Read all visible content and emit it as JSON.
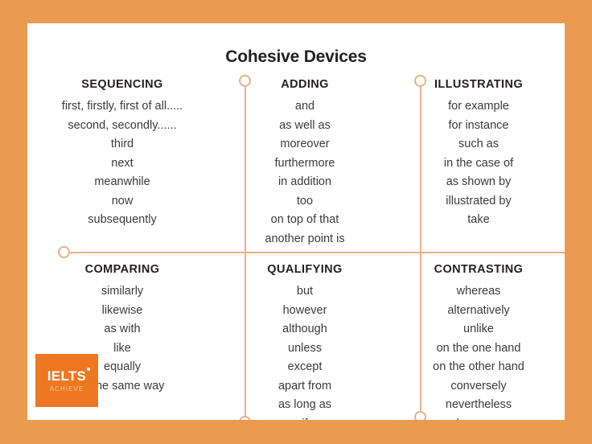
{
  "poster": {
    "title": "Cohesive Devices",
    "border_color": "#eb9b51",
    "card_color": "#ffffff",
    "line_color": "#e3b387",
    "text_color": "#3b3b3b",
    "heading_color": "#231f20"
  },
  "categories": [
    {
      "id": "sequencing",
      "title": "SEQUENCING",
      "items": [
        "first, firstly, first of all.....",
        "second, secondly......",
        "third",
        "next",
        "meanwhile",
        "now",
        "subsequently"
      ]
    },
    {
      "id": "adding",
      "title": "ADDING",
      "items": [
        "and",
        "as well as",
        "moreover",
        "furthermore",
        "in addition",
        "too",
        "on top of that",
        "another point is"
      ]
    },
    {
      "id": "illustrating",
      "title": "ILLUSTRATING",
      "items": [
        "for example",
        "for instance",
        "such as",
        "in the case of",
        "as shown by",
        "illustrated by",
        "take"
      ]
    },
    {
      "id": "comparing",
      "title": "COMPARING",
      "items": [
        "similarly",
        "likewise",
        "as with",
        "like",
        "equally",
        "in the same way"
      ]
    },
    {
      "id": "qualifying",
      "title": "QUALIFYING",
      "items": [
        "but",
        "however",
        "although",
        "unless",
        "except",
        "apart from",
        "as long as",
        "if"
      ]
    },
    {
      "id": "contrasting",
      "title": "CONTRASTING",
      "items": [
        "whereas",
        "alternatively",
        "unlike",
        "on the one hand",
        "on the other hand",
        "conversely",
        "nevertheless",
        "however"
      ]
    }
  ],
  "logo": {
    "primary_text": "IELTS",
    "secondary_text": "ACHIEVE",
    "background_color": "#ee7722"
  }
}
